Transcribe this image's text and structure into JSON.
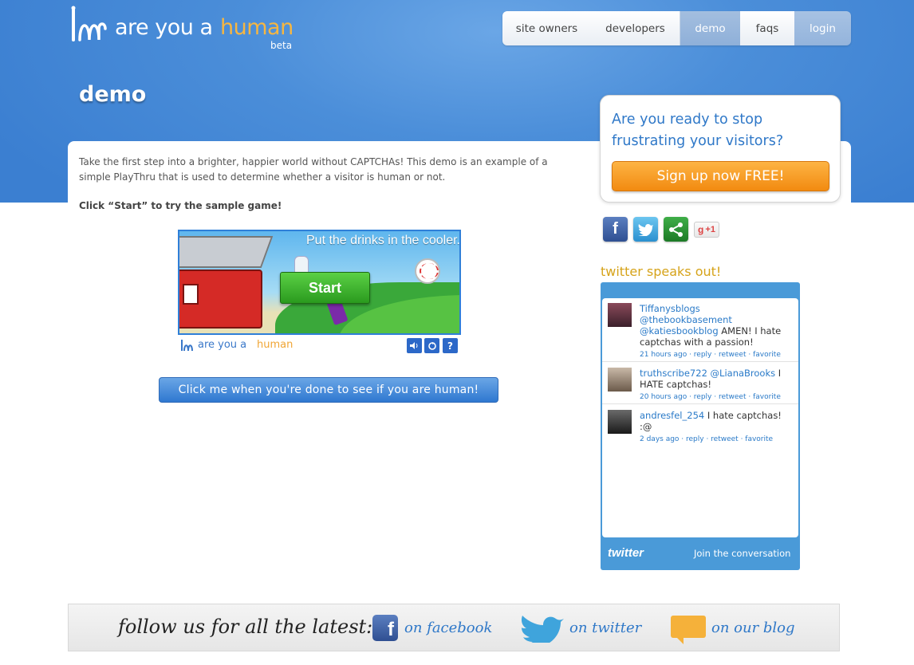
{
  "header": {
    "logo_text_1": "are you a",
    "logo_text_2": "human",
    "logo_beta": "beta",
    "nav": [
      "site owners",
      "developers",
      "demo",
      "faqs",
      "login"
    ]
  },
  "page": {
    "title": "demo",
    "intro": "Take the first step into a brighter, happier world without CAPTCHAs!  This demo is an example of a simple PlayThru that is used to determine whether a visitor is human or not.",
    "cta_text": "Click “Start” to try the sample game!",
    "game": {
      "prompt": "Put the drinks in the cooler.",
      "start_label": "Start",
      "brand_1": "are you a",
      "brand_2": "human",
      "sound_icon": "speaker-icon",
      "refresh_icon": "refresh-icon",
      "help_label": "?"
    },
    "check_button": "Click me when you're done to see if you are human!"
  },
  "sidebar": {
    "signup_question": "Are you ready to stop frustrating your visitors?",
    "signup_button": "Sign up now FREE!",
    "social": [
      "facebook-icon",
      "twitter-icon",
      "share-icon",
      "google-plus-one-icon"
    ],
    "gplus_label": "+1",
    "twitter_heading": "twitter speaks out!",
    "tweets": [
      {
        "user": "Tiffanysblogs",
        "text_1": "@thebookbasement",
        "text_2": "@katiesbookblog",
        "text_3": "AMEN! I hate captchas with a passion!",
        "meta": "21 hours ago · reply · retweet · favorite"
      },
      {
        "user": "truthscribe722",
        "text_1": "@LianaBrooks",
        "text_3": "I HATE captchas!",
        "meta": "20 hours ago · reply · retweet · favorite"
      },
      {
        "user": "andresfel_254",
        "text_3": "I hate captchas! :@",
        "meta": "2 days ago · reply · retweet · favorite"
      }
    ],
    "twitter_logo": "twitter",
    "join": "Join the conversation"
  },
  "footer": {
    "lead": "follow us for all the latest:",
    "facebook": "on facebook",
    "twitter": "on twitter",
    "blog": "on our blog"
  },
  "colors": {
    "header_blue": "#3b7fd1",
    "accent_orange": "#f28a10",
    "link_blue": "#2f78c8"
  }
}
